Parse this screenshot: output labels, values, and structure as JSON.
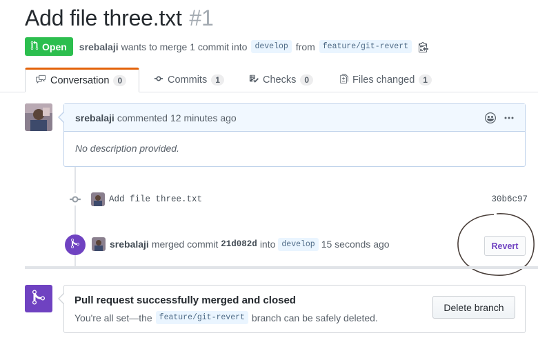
{
  "pr": {
    "title": "Add file three.txt",
    "number": "#1",
    "state": "Open",
    "author": "srebalaji",
    "merge_text": "wants to merge 1 commit into",
    "base_branch": "develop",
    "from_text": "from",
    "head_branch": "feature/git-revert"
  },
  "tabs": [
    {
      "label": "Conversation",
      "count": "0"
    },
    {
      "label": "Commits",
      "count": "1"
    },
    {
      "label": "Checks",
      "count": "0"
    },
    {
      "label": "Files changed",
      "count": "1"
    }
  ],
  "comment": {
    "author": "srebalaji",
    "action": "commented",
    "time": "12 minutes ago",
    "body": "No description provided."
  },
  "commit": {
    "message": "Add file three.txt",
    "sha": "30b6c97"
  },
  "merge_event": {
    "author": "srebalaji",
    "action": "merged commit",
    "sha": "21d082d",
    "into_text": "into",
    "branch": "develop",
    "time": "15 seconds ago",
    "revert_label": "Revert"
  },
  "merged_box": {
    "title": "Pull request successfully merged and closed",
    "sub_before": "You're all set—the",
    "branch": "feature/git-revert",
    "sub_after": "branch can be safely deleted.",
    "delete_label": "Delete branch"
  },
  "colors": {
    "open_green": "#2cbe4e",
    "merged_purple": "#6f42c1",
    "tab_accent": "#e36209"
  }
}
